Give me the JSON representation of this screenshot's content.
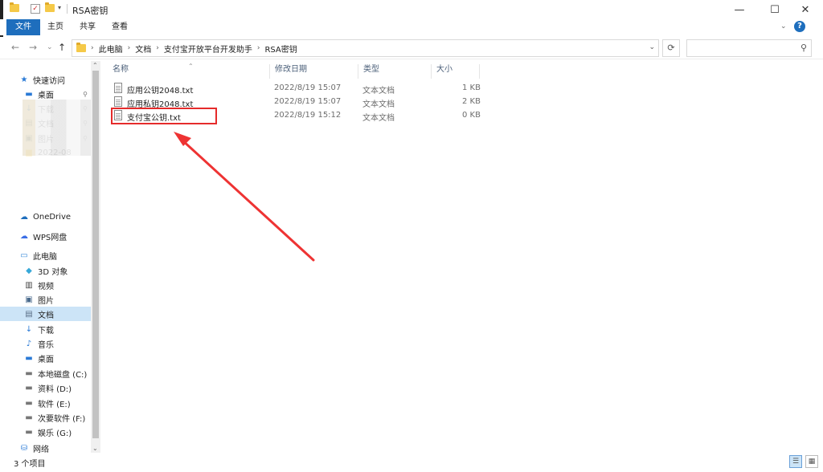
{
  "window": {
    "title": "RSA密钥",
    "minimize": "—",
    "maximize": "☐",
    "close": "✕"
  },
  "ribbon": {
    "tabs": [
      "文件",
      "主页",
      "共享",
      "查看"
    ],
    "collapse": "⌄",
    "help": "?"
  },
  "navigation": {
    "back": "←",
    "forward": "→",
    "recent": "⌄",
    "up": "↑",
    "breadcrumbs": [
      "此电脑",
      "文档",
      "支付宝开放平台开发助手",
      "RSA密钥"
    ],
    "refresh": "⟳",
    "search_placeholder": ""
  },
  "sidebar": {
    "items": [
      {
        "label": "快速访问",
        "icon": "star-icon"
      },
      {
        "label": "桌面",
        "icon": "desktop-icon",
        "pinned": true
      },
      {
        "label": "下载",
        "icon": "download-icon",
        "pinned": true
      },
      {
        "label": "文档",
        "icon": "document-icon",
        "pinned": true
      },
      {
        "label": "图片",
        "icon": "picture-icon",
        "pinned": true
      },
      {
        "label": "2022-08",
        "icon": "folder-icon"
      },
      {
        "label": "OneDrive",
        "icon": "cloud-icon"
      },
      {
        "label": "WPS网盘",
        "icon": "wps-cloud-icon"
      },
      {
        "label": "此电脑",
        "icon": "pc-icon"
      },
      {
        "label": "3D 对象",
        "icon": "cube-icon"
      },
      {
        "label": "视频",
        "icon": "video-icon"
      },
      {
        "label": "图片",
        "icon": "picture-icon"
      },
      {
        "label": "文档",
        "icon": "document-icon",
        "selected": true
      },
      {
        "label": "下载",
        "icon": "download-icon"
      },
      {
        "label": "音乐",
        "icon": "music-icon"
      },
      {
        "label": "桌面",
        "icon": "desktop-icon"
      },
      {
        "label": "本地磁盘 (C:)",
        "icon": "drive-icon"
      },
      {
        "label": "资料 (D:)",
        "icon": "drive-icon"
      },
      {
        "label": "软件 (E:)",
        "icon": "drive-icon"
      },
      {
        "label": "次要软件 (F:)",
        "icon": "drive-icon"
      },
      {
        "label": "娱乐 (G:)",
        "icon": "drive-icon"
      },
      {
        "label": "网络",
        "icon": "network-icon"
      }
    ]
  },
  "columns": {
    "name": "名称",
    "modified": "修改日期",
    "type": "类型",
    "size": "大小"
  },
  "files": [
    {
      "name": "应用公钥2048.txt",
      "modified": "2022/8/19 15:07",
      "type": "文本文档",
      "size": "1 KB"
    },
    {
      "name": "应用私钥2048.txt",
      "modified": "2022/8/19 15:07",
      "type": "文本文档",
      "size": "2 KB"
    },
    {
      "name": "支付宝公钥.txt",
      "modified": "2022/8/19 15:12",
      "type": "文本文档",
      "size": "0 KB"
    }
  ],
  "status": {
    "item_count": "3 个项目"
  },
  "colors": {
    "accent": "#1e6ebd",
    "highlight": "#e52b2b",
    "selection": "#cce4f7"
  }
}
